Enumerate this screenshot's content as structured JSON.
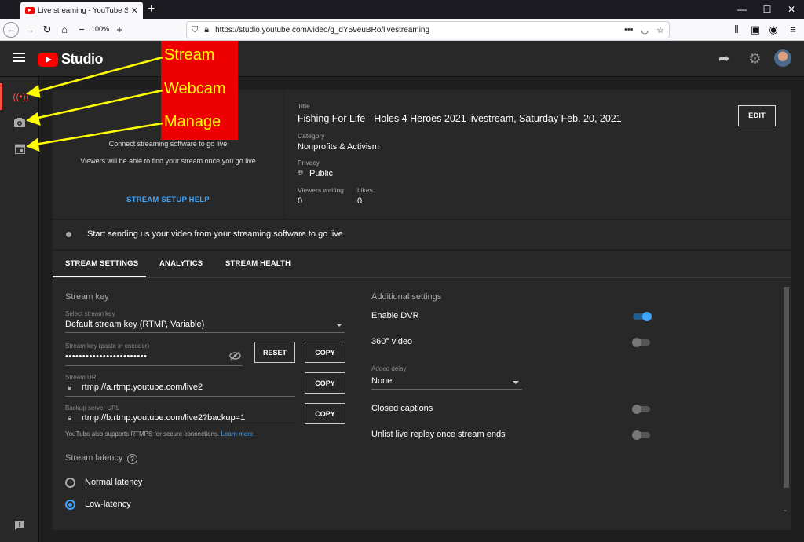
{
  "browser": {
    "tab_title": "Live streaming - YouTube Studio",
    "tab_close": "✕",
    "new_tab": "+",
    "zoom": "100%",
    "url": "https://studio.youtube.com/video/g_dY59euBRo/livestreaming",
    "page_actions": "•••",
    "minimize": "—",
    "maximize": "☐",
    "close": "✕"
  },
  "header": {
    "logo_text": "Studio"
  },
  "annotation": {
    "stream": "Stream",
    "webcam": "Webcam",
    "manage": "Manage",
    "color": "#ee0000",
    "text_color": "#ffff00"
  },
  "preview": {
    "line1": "Connect streaming software to go live",
    "line2": "Viewers will be able to find your stream once you go live",
    "help_link": "STREAM SETUP HELP"
  },
  "info": {
    "title_label": "Title",
    "title": "Fishing For Life - Holes 4 Heroes 2021 livestream, Saturday Feb. 20, 2021",
    "category_label": "Category",
    "category": "Nonprofits & Activism",
    "privacy_label": "Privacy",
    "privacy": "Public",
    "viewers_label": "Viewers waiting",
    "viewers": "0",
    "likes_label": "Likes",
    "likes": "0",
    "edit_button": "EDIT"
  },
  "status": {
    "text": "Start sending us your video from your streaming software to go live"
  },
  "tabs": {
    "stream_settings": "STREAM SETTINGS",
    "analytics": "ANALYTICS",
    "stream_health": "STREAM HEALTH"
  },
  "stream_key": {
    "section_title": "Stream key",
    "select_label": "Select stream key",
    "select_value": "Default stream key (RTMP, Variable)",
    "key_label": "Stream key (paste in encoder)",
    "key_value": "••••••••••••••••••••••••",
    "reset_button": "RESET",
    "copy_button": "COPY",
    "url_label": "Stream URL",
    "url_value": "rtmp://a.rtmp.youtube.com/live2",
    "backup_label": "Backup server URL",
    "backup_value": "rtmp://b.rtmp.youtube.com/live2?backup=1",
    "rtmps_note": "YouTube also supports RTMPS for secure connections.",
    "learn_more": "Learn more"
  },
  "latency": {
    "section_title": "Stream latency",
    "help": "?",
    "options": [
      {
        "label": "Normal latency",
        "selected": false
      },
      {
        "label": "Low-latency",
        "selected": true
      }
    ]
  },
  "additional": {
    "section_title": "Additional settings",
    "enable_dvr": "Enable DVR",
    "enable_dvr_on": true,
    "video_360": "360° video",
    "video_360_on": false,
    "delay_label": "Added delay",
    "delay_value": "None",
    "closed_captions": "Closed captions",
    "closed_captions_on": false,
    "unlist_replay": "Unlist live replay once stream ends",
    "unlist_replay_on": false
  },
  "colors": {
    "accent": "#3ea6ff",
    "live_red": "#ff4e45",
    "background": "#1f1f1f",
    "panel": "#282828"
  }
}
